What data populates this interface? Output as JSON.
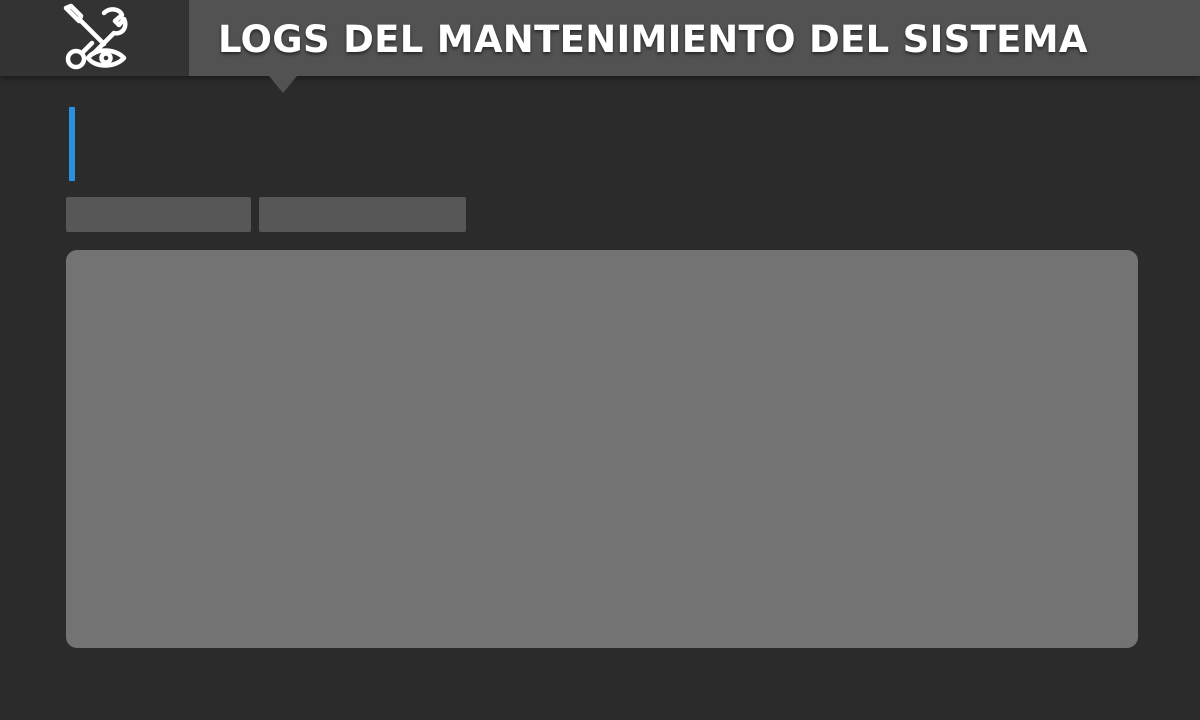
{
  "header": {
    "title": "LOGS DEL MANTENIMIENTO DEL SISTEMA",
    "icon": "maintenance-tools-eye-icon"
  },
  "section": {
    "accent_color": "#2a8fdc"
  },
  "tabs": [
    {
      "label": ""
    },
    {
      "label": ""
    }
  ],
  "log_panel": {
    "content": ""
  }
}
